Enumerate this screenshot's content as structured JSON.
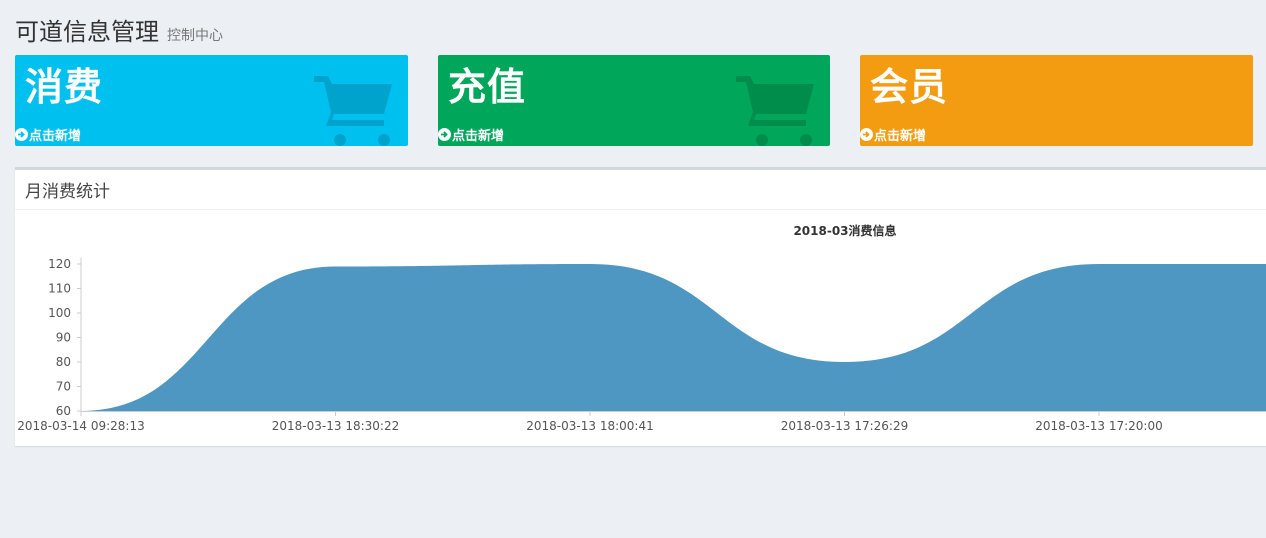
{
  "header": {
    "title": "可道信息管理",
    "subtitle": "控制中心"
  },
  "tiles": [
    {
      "title": "消费",
      "link": "点击新增",
      "color": "#00c0ef",
      "icon": "shopping-cart-icon"
    },
    {
      "title": "充值",
      "link": "点击新增",
      "color": "#00a65a",
      "icon": "shopping-cart-icon"
    },
    {
      "title": "会员",
      "link": "点击新增",
      "color": "#f39c12",
      "icon": ""
    }
  ],
  "panel": {
    "title": "月消费统计"
  },
  "chart_data": {
    "type": "area",
    "title": "2018-03消费信息",
    "x": [
      "2018-03-14 09:28:13",
      "2018-03-13 18:30:22",
      "2018-03-13 18:00:41",
      "2018-03-13 17:26:29",
      "2018-03-13 17:20:00",
      ""
    ],
    "x_tick_labels": [
      "2018-03-14 09:28:13",
      "2018-03-13 18:30:22",
      "2018-03-13 18:00:41",
      "2018-03-13 17:26:29",
      "2018-03-13 17:20:00"
    ],
    "values": [
      60,
      119,
      120,
      80,
      120,
      120
    ],
    "y_ticks": [
      60,
      70,
      80,
      90,
      100,
      110,
      120
    ],
    "ylim": [
      60,
      120
    ],
    "fill_color": "#4f97c3",
    "grid": false,
    "legend": "none"
  }
}
